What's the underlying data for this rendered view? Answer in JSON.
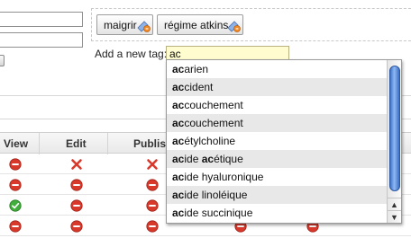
{
  "form": {
    "tags": [
      {
        "label": "maigrir",
        "remove_icon": "remove-tag-icon"
      },
      {
        "label": "régime atkins",
        "remove_icon": "remove-tag-icon"
      }
    ],
    "add_tag_label": "Add a new tag:",
    "add_tag_value": "ac"
  },
  "autocomplete": {
    "query": "ac",
    "suggestions": [
      {
        "match": "ac",
        "rest": "arien"
      },
      {
        "match": "ac",
        "rest": "cident"
      },
      {
        "match": "ac",
        "rest": "couchement"
      },
      {
        "match": "ac",
        "rest": "couchement"
      },
      {
        "match": "ac",
        "rest": "étylcholine"
      },
      {
        "match": "ac",
        "rest": "ide acétique",
        "extra_bold": "ac"
      },
      {
        "match": "ac",
        "rest": "ide hyaluronique"
      },
      {
        "match": "ac",
        "rest": "ide linoléique"
      },
      {
        "match": "ac",
        "rest": "ide succinique"
      }
    ]
  },
  "table": {
    "columns": [
      "View",
      "Edit",
      "Publish"
    ],
    "rows": [
      [
        "red-circle-icon",
        "red-x-icon",
        "red-x-icon"
      ],
      [
        "red-circle-icon",
        "red-circle-icon",
        "red-circle-icon"
      ],
      [
        "green-check-icon",
        "red-circle-icon",
        "red-circle-icon"
      ],
      [
        "red-circle-icon",
        "red-circle-icon",
        "red-circle-icon"
      ]
    ]
  },
  "colors": {
    "input_highlight": "#fffccf",
    "scroll_thumb": "#5a8de0",
    "deny": "#d8392b",
    "allow": "#3fae3a"
  }
}
